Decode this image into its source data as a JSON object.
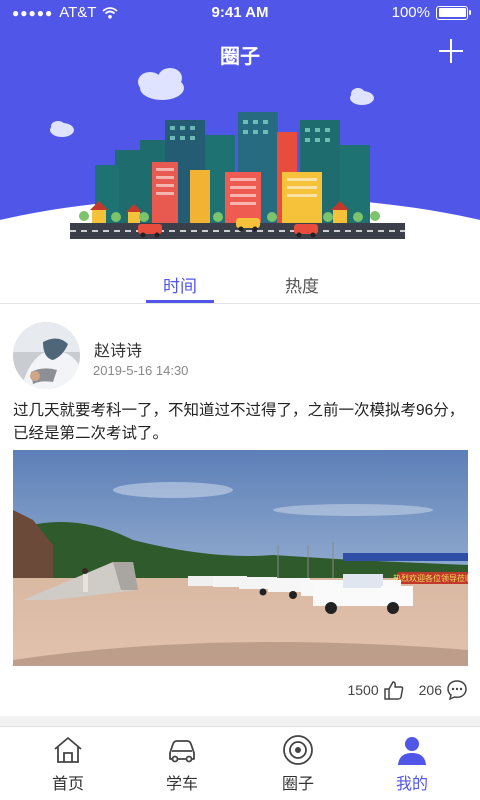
{
  "status_bar": {
    "carrier": "AT&T",
    "time": "9:41 AM",
    "battery": "100%"
  },
  "header": {
    "title": "圈子"
  },
  "tabs": [
    {
      "label": "时间",
      "active": true
    },
    {
      "label": "热度",
      "active": false
    }
  ],
  "post": {
    "username": "赵诗诗",
    "timestamp": "2019-5-16 14:30",
    "text": "过几天就要考科一了，不知道过不过得了，之前一次模拟考96分，已经是第二次考试了。",
    "likes": "1500",
    "comments": "206",
    "photo_banner": "热烈欢迎各位领导莅临"
  },
  "bottom_nav": [
    {
      "label": "首页",
      "icon": "home-icon",
      "active": false
    },
    {
      "label": "学车",
      "icon": "car-icon",
      "active": false
    },
    {
      "label": "圈子",
      "icon": "circle-icon",
      "active": false
    },
    {
      "label": "我的",
      "icon": "user-icon",
      "active": true
    }
  ],
  "colors": {
    "accent": "#4f56e8",
    "text": "#333333",
    "muted": "#888888"
  }
}
